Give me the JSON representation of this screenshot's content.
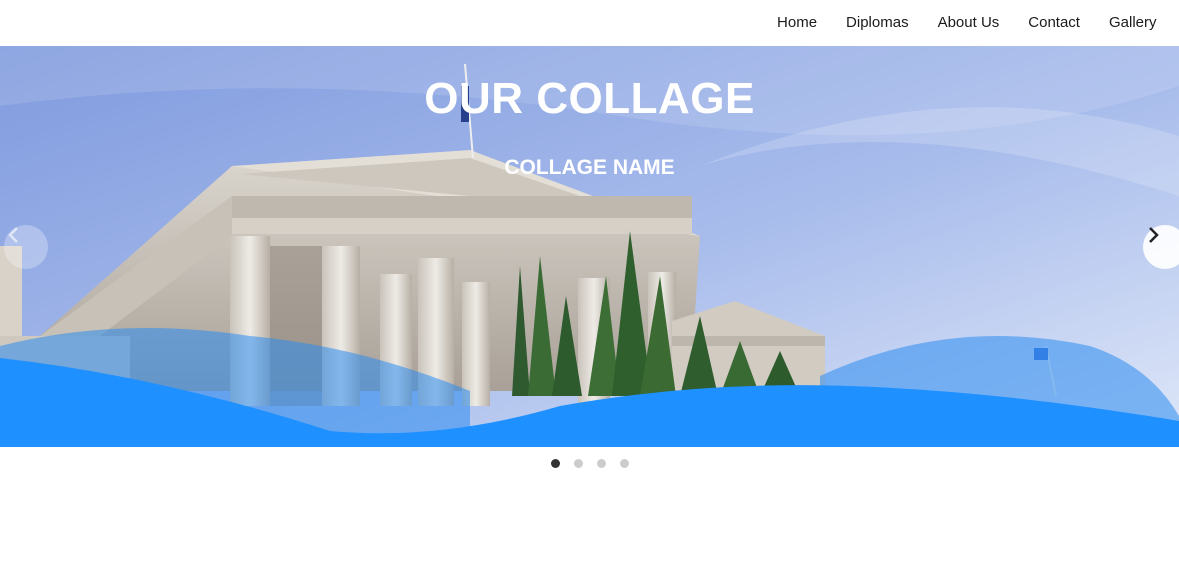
{
  "nav": {
    "items": [
      {
        "label": "Home"
      },
      {
        "label": "Diplomas"
      },
      {
        "label": "About Us"
      },
      {
        "label": "Contact"
      },
      {
        "label": "Gallery"
      }
    ]
  },
  "slider": {
    "title": "OUR COLLAGE",
    "subtitle": "COLLAGE NAME",
    "prev_icon": "chevron-left-icon",
    "next_icon": "chevron-right-icon",
    "slide_count": 4,
    "active_slide": 1,
    "wave_color": "#1e90ff",
    "sky_color": "#8fa9e6"
  }
}
